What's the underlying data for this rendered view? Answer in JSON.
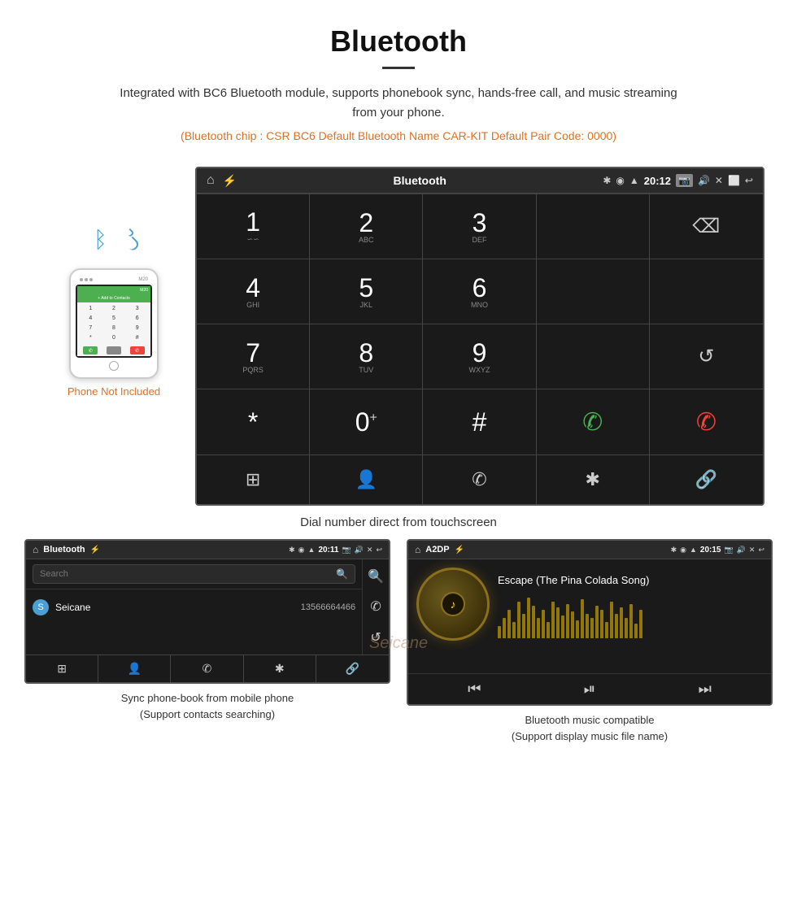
{
  "header": {
    "title": "Bluetooth",
    "description": "Integrated with BC6 Bluetooth module, supports phonebook sync, hands-free call, and music streaming from your phone.",
    "specs": "(Bluetooth chip : CSR BC6   Default Bluetooth Name CAR-KIT    Default Pair Code: 0000)"
  },
  "main_screen": {
    "status_bar": {
      "title": "Bluetooth",
      "time": "20:12"
    },
    "dialpad": [
      {
        "number": "1",
        "letters": "∽∽"
      },
      {
        "number": "2",
        "letters": "ABC"
      },
      {
        "number": "3",
        "letters": "DEF"
      },
      {
        "number": "",
        "letters": ""
      },
      {
        "number": "⌫",
        "letters": ""
      },
      {
        "number": "4",
        "letters": "GHI"
      },
      {
        "number": "5",
        "letters": "JKL"
      },
      {
        "number": "6",
        "letters": "MNO"
      },
      {
        "number": "",
        "letters": ""
      },
      {
        "number": "",
        "letters": ""
      },
      {
        "number": "7",
        "letters": "PQRS"
      },
      {
        "number": "8",
        "letters": "TUV"
      },
      {
        "number": "9",
        "letters": "WXYZ"
      },
      {
        "number": "",
        "letters": ""
      },
      {
        "number": "↺",
        "letters": ""
      },
      {
        "number": "*",
        "letters": ""
      },
      {
        "number": "0",
        "letters": "+"
      },
      {
        "number": "#",
        "letters": ""
      },
      {
        "number": "📞",
        "letters": ""
      },
      {
        "number": "📞end",
        "letters": ""
      }
    ],
    "toolbar": [
      "⊞",
      "👤",
      "📞",
      "✱",
      "🔗"
    ]
  },
  "main_caption": "Dial number direct from touchscreen",
  "phone_not_included": "Phone Not Included",
  "bottom_left": {
    "status_bar": {
      "title": "Bluetooth",
      "time": "20:11"
    },
    "search_placeholder": "Search",
    "contact": {
      "initial": "S",
      "name": "Seicane",
      "number": "13566664466"
    },
    "caption_line1": "Sync phone-book from mobile phone",
    "caption_line2": "(Support contacts searching)"
  },
  "bottom_right": {
    "status_bar": {
      "title": "A2DP",
      "time": "20:15"
    },
    "song_title": "Escape (The Pina Colada Song)",
    "caption_line1": "Bluetooth music compatible",
    "caption_line2": "(Support display music file name)"
  },
  "icons": {
    "home": "⌂",
    "usb": "⚡",
    "bluetooth": "✱",
    "location": "◉",
    "signal": "▲",
    "camera": "📷",
    "volume": "🔊",
    "close": "✕",
    "back": "↩",
    "dialpad": "⊞",
    "contacts": "👤",
    "call": "📞",
    "bt": "✱",
    "link": "🔗",
    "search": "🔍",
    "refresh": "↺",
    "prev": "⏮",
    "playpause": "⏯",
    "next": "⏭"
  },
  "visualizer_bars": [
    15,
    25,
    35,
    20,
    45,
    30,
    50,
    40,
    25,
    35,
    20,
    45,
    38,
    28,
    42,
    33,
    22,
    48,
    30,
    25,
    40,
    35,
    20,
    45,
    30,
    38,
    25,
    42,
    18,
    35
  ]
}
